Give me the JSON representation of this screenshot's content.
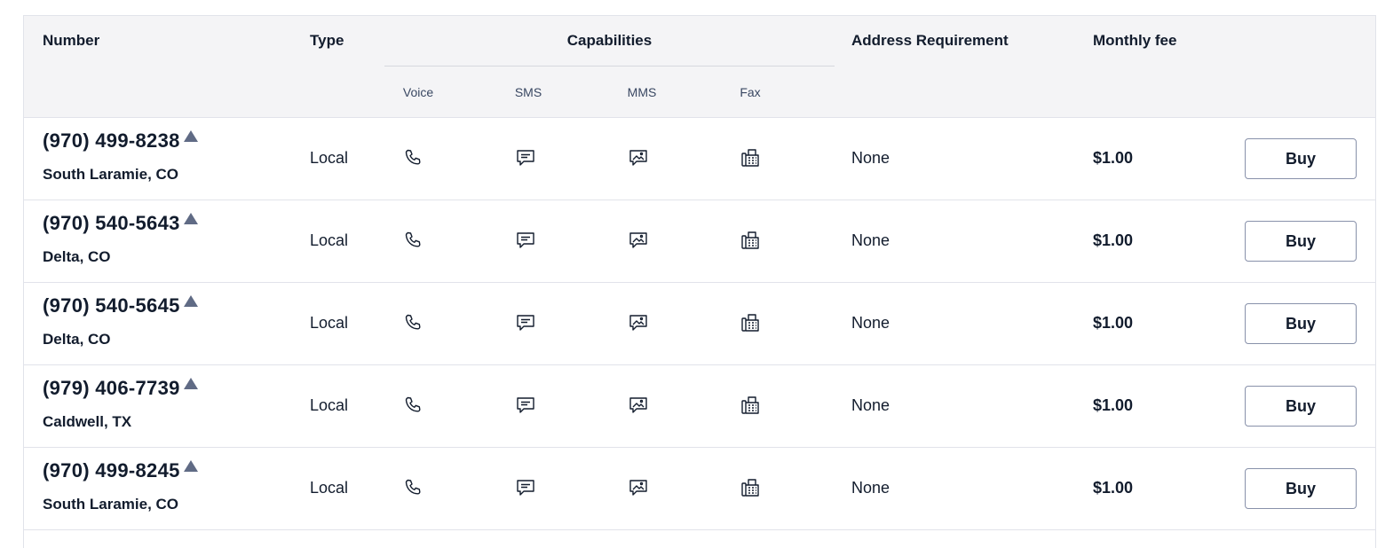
{
  "table": {
    "headers": {
      "number": "Number",
      "type": "Type",
      "capabilities": "Capabilities",
      "address_requirement": "Address Requirement",
      "monthly_fee": "Monthly fee",
      "sub": {
        "voice": "Voice",
        "sms": "SMS",
        "mms": "MMS",
        "fax": "Fax"
      }
    },
    "rows": [
      {
        "number": "(970) 499-8238",
        "location": "South Laramie, CO",
        "type": "Local",
        "address": "None",
        "fee": "$1.00",
        "action": "Buy"
      },
      {
        "number": "(970) 540-5643",
        "location": "Delta, CO",
        "type": "Local",
        "address": "None",
        "fee": "$1.00",
        "action": "Buy"
      },
      {
        "number": "(970) 540-5645",
        "location": "Delta, CO",
        "type": "Local",
        "address": "None",
        "fee": "$1.00",
        "action": "Buy"
      },
      {
        "number": "(979) 406-7739",
        "location": "Caldwell, TX",
        "type": "Local",
        "address": "None",
        "fee": "$1.00",
        "action": "Buy"
      },
      {
        "number": "(970) 499-8245",
        "location": "South Laramie, CO",
        "type": "Local",
        "address": "None",
        "fee": "$1.00",
        "action": "Buy"
      }
    ],
    "row_icons": [
      "phone-icon",
      "sms-icon",
      "mms-icon",
      "fax-icon"
    ],
    "colors": {
      "header_bg": "#f4f4f6",
      "text": "#121c2d",
      "muted": "#606b85",
      "border": "#e1e3ea"
    }
  }
}
